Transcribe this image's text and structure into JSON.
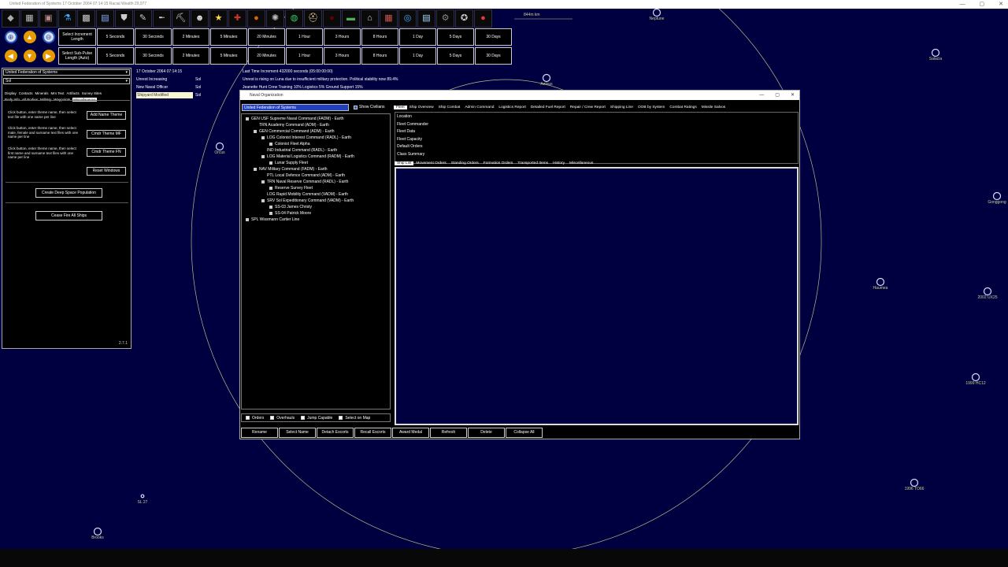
{
  "window": {
    "title": "United Federation of Systems   17 October 2064 07:14:15   Racial Wealth 29,977"
  },
  "toolbar": {
    "icons": [
      "gem-icon",
      "cube-icon",
      "chest-icon",
      "flask-icon",
      "grid-icon",
      "document-icon",
      "shield-icon",
      "pen-icon",
      "rifle-icon",
      "pickaxe-icon",
      "officer-icon",
      "star-icon",
      "union-flag-icon",
      "dark-planet-icon",
      "galaxy-icon",
      "globe-icon",
      "helmet-icon",
      "black-orb-icon",
      "cash-icon",
      "factory-icon",
      "calendar-icon",
      "cycle-icon",
      "list-icon",
      "gear-icon",
      "medal-icon",
      "red-orb-icon"
    ],
    "glyphs": [
      "◆",
      "▦",
      "▣",
      "⚗",
      "▩",
      "▤",
      "⛊",
      "✎",
      "╾",
      "⛏",
      "☻",
      "★",
      "✚",
      "●",
      "✺",
      "◍",
      "⛑",
      "●",
      "▬",
      "⌂",
      "▦",
      "◎",
      "▤",
      "⚙",
      "✪",
      "●"
    ]
  },
  "increment": {
    "label": "Select Increment Length",
    "options": [
      "5 Seconds",
      "30 Seconds",
      "2 Minutes",
      "5 Minutes",
      "20 Minutes",
      "1 Hour",
      "3 Hours",
      "8 Hours",
      "1 Day",
      "5 Days",
      "30 Days"
    ]
  },
  "subpulse": {
    "label": "Select Sub-Pulse Length (Auto)",
    "options": [
      "5 Seconds",
      "30 Seconds",
      "2 Minutes",
      "5 Minutes",
      "20 Minutes",
      "1 Hour",
      "3 Hours",
      "8 Hours",
      "1 Day",
      "5 Days",
      "30 Days"
    ]
  },
  "left_panel": {
    "race_select": "United Federation of Systems",
    "system_select": "Sol",
    "tabs_row1": [
      "Display",
      "Contacts",
      "Minerals",
      "Mm Text",
      "Artifacts",
      "Survey Sites"
    ],
    "tabs_row2": [
      "Body Info",
      "All Bodies",
      "Military",
      "Waypoints",
      "Miscellaneous"
    ],
    "active_tab": "Miscellaneous",
    "instr1": "Click button, enter theme name, then select text file with one name per line",
    "instr2": "Click button, enter theme name, then select male, female and surname text files with one name per line",
    "instr3": "Click button, enter theme name, then select first name and surname text files with one name per line",
    "btn_add_name_theme": "Add Name Theme",
    "btn_cmdr_theme_mf": "Cmdr Theme MF",
    "btn_cmdr_theme_fn": "Cmdr Theme FN",
    "btn_reset_windows": "Reset Windows",
    "btn_deep_space": "Create Deep Space Population",
    "btn_cease_fire": "Cease Fire All Ships",
    "version": "2.7.1"
  },
  "events": {
    "date": "17 October 2064 07:14:15",
    "items": [
      {
        "type": "Unrest Increasing",
        "system": "Sol"
      },
      {
        "type": "New Naval Officer",
        "system": "Sol"
      },
      {
        "type": "Shipyard Modified",
        "system": "Sol"
      }
    ],
    "last_increment": "Last Time Increment 432000 seconds (05:00:00:00)",
    "unrest_msg": "Unrest is rising on Luna due to insufficient military protection. Political stability now 89.4%",
    "officer_msg": "Jeanette Hunt     Crew Training 10%     Logistics 5%     Ground Support 15%"
  },
  "map": {
    "scale": "844m km",
    "bodies": [
      {
        "name": "Neptune"
      },
      {
        "name": "Salacia"
      },
      {
        "name": "Aelous"
      },
      {
        "name": "Orcus"
      },
      {
        "name": "Gonggong"
      },
      {
        "name": "Haumea"
      },
      {
        "name": "2002 UX25"
      },
      {
        "name": "1999 HC12"
      },
      {
        "name": "1996 TO66"
      },
      {
        "name": "SL 27"
      },
      {
        "name": "Brooks"
      }
    ]
  },
  "naval": {
    "title": "Naval Organization",
    "race_select": "United Federation of Systems",
    "show_civilians": "Show Civilians",
    "tree": [
      {
        "label": "GEN USF Supreme Naval Command  (FADM) - Earth",
        "level": 0,
        "box": true
      },
      {
        "label": "TRN Academy Command  (ADM) - Earth",
        "level": 1,
        "box": false
      },
      {
        "label": "GEN Commercial Command  (ADM) - Earth",
        "level": 1,
        "box": true
      },
      {
        "label": "LOG Colonist Interest Command  (RADL) - Earth",
        "level": 2,
        "box": true
      },
      {
        "label": "Colonist Fleet Alpha",
        "level": 3,
        "box": true
      },
      {
        "label": "IND Industrial Command  (RADL) - Earth",
        "level": 2,
        "box": false
      },
      {
        "label": "LOG Material Logistics Command  (RADM) - Earth",
        "level": 2,
        "box": true
      },
      {
        "label": "Lunar Supply Fleet",
        "level": 3,
        "box": true
      },
      {
        "label": "NAV Military Command  (FADM) - Earth",
        "level": 1,
        "box": true
      },
      {
        "label": "PTL Local Defence Command  (ADM) - Earth",
        "level": 2,
        "box": false
      },
      {
        "label": "TRN Naval Reserve Command  (RADL) - Earth",
        "level": 2,
        "box": true
      },
      {
        "label": "Reserve Survey Fleet",
        "level": 3,
        "box": true
      },
      {
        "label": "LOG Rapid Mobility Command  (VADM) - Earth",
        "level": 2,
        "box": false
      },
      {
        "label": "SRV Sol Expeditionary Command  (VADM) - Earth",
        "level": 2,
        "box": true
      },
      {
        "label": "SS-03 James Christy",
        "level": 3,
        "box": true
      },
      {
        "label": "SS-04 Patrick Moore",
        "level": 3,
        "box": true
      },
      {
        "label": "SPL Wissmann Cartier Line",
        "level": 0,
        "box": true
      }
    ],
    "tree_options": [
      "Orders",
      "Overhauls",
      "Jump Capable",
      "Select on Map"
    ],
    "buttons": [
      "Rename",
      "Select Name",
      "Detach Escorts",
      "Recall Escorts",
      "Award Medal",
      "Refresh",
      "Delete",
      "Collapse All"
    ],
    "tabs": [
      "Fleet",
      "Ship Overview",
      "Ship Combat",
      "Admin Command",
      "Logistics Report",
      "Detailed Fuel Report",
      "Repair / Crew Report",
      "Shipping Line",
      "OOB by System",
      "Combat Ratings",
      "Missile Salvos"
    ],
    "fleet_info": [
      "Location",
      "Fleet Commander",
      "Fleet Data",
      "Fleet Capacity",
      "Default Orders",
      "Class Summary"
    ],
    "sub_tabs": [
      "Ship List",
      "Movement Orders",
      "Standing Orders",
      "Formation Orders",
      "Transported Items",
      "History",
      "Miscellaneous"
    ]
  },
  "colors": {
    "background": "#000040",
    "orbit": "#c8d090",
    "accent": "#2040c0",
    "arrow": "#e89b00"
  }
}
